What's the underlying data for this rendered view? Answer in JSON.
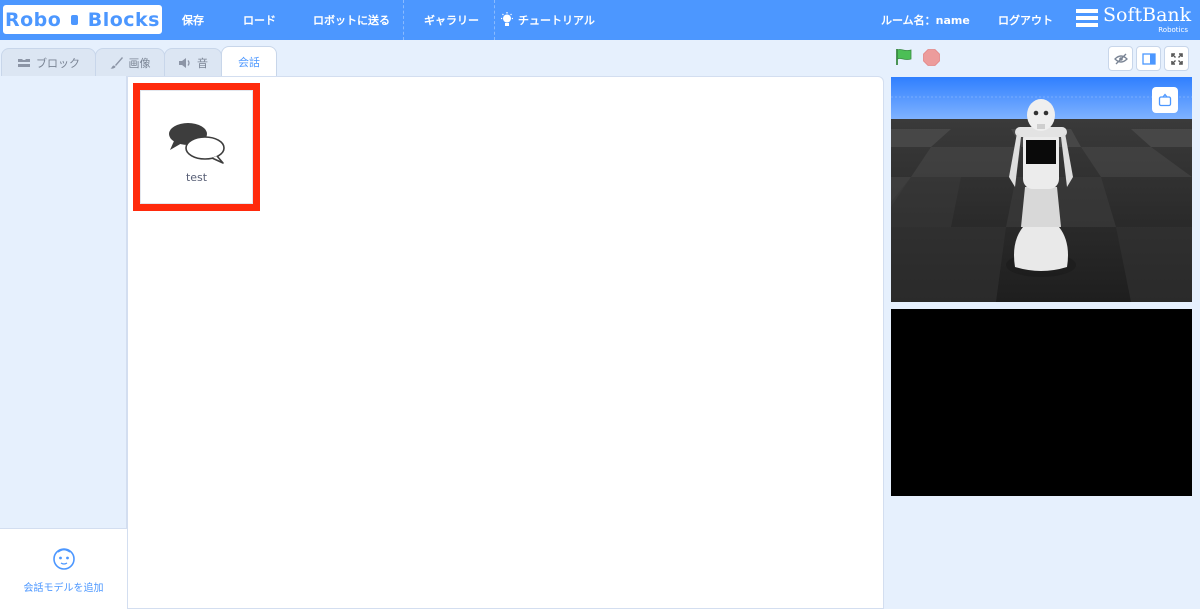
{
  "app": {
    "logo_left": "Robo",
    "logo_right": "Blocks"
  },
  "nav": {
    "save": "保存",
    "load": "ロード",
    "send_to_robot": "ロボットに送る",
    "gallery": "ギャラリー",
    "tutorial": "チュートリアル",
    "room_name": "ルーム名：name",
    "logout": "ログアウト",
    "brand": "SoftBank",
    "brand_sub": "Robotics",
    "bulb_icon": "lightbulb-icon"
  },
  "tabs": [
    {
      "label": "ブロック",
      "icon": "blocks-icon",
      "active": false
    },
    {
      "label": "画像",
      "icon": "paintbrush-icon",
      "active": false
    },
    {
      "label": "音",
      "icon": "speaker-icon",
      "active": false
    },
    {
      "label": "会話",
      "icon": "",
      "active": true
    }
  ],
  "sidebar": {
    "add_model_label": "会話モデルを追加",
    "add_model_icon": "robot-face-icon"
  },
  "conversations": [
    {
      "name": "test",
      "icon": "speech-bubbles-icon",
      "selected": true
    }
  ],
  "stage": {
    "flag_icon": "green-flag-icon",
    "stop_icon": "stop-icon",
    "buttons": [
      "hide-eye-icon",
      "small-stage-icon",
      "fullscreen-icon"
    ],
    "camera_button": "camera-switch-icon"
  },
  "colors": {
    "primary": "#4c97ff",
    "highlight_frame": "#ff2a0c",
    "flag_green": "#4cbf56",
    "stop_red": "#ec9c9c"
  }
}
